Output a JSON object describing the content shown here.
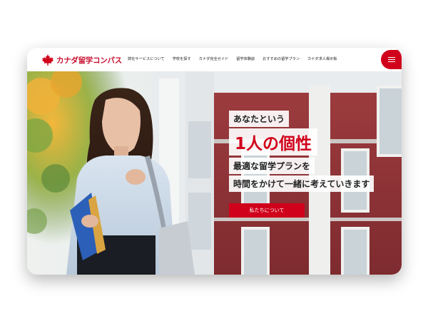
{
  "brand": {
    "name": "カナダ留学コンパス",
    "accent_color": "#d0021b",
    "logo_icon": "maple-leaf-icon"
  },
  "nav": {
    "items": [
      {
        "label": "弊社サービスについて"
      },
      {
        "label": "学校を探す"
      },
      {
        "label": "カナダ完全ガイド"
      },
      {
        "label": "留学体験談"
      },
      {
        "label": "おすすめの留学プラン"
      },
      {
        "label": "カナダ求人掲示板"
      }
    ],
    "menu_icon": "hamburger-menu-icon"
  },
  "hero": {
    "line1": "あなたという",
    "line2": "1人の個性",
    "line3": "最適な留学プランを",
    "line4": "時間をかけて一緒に考えていきます",
    "cta_label": "私たちについて"
  }
}
